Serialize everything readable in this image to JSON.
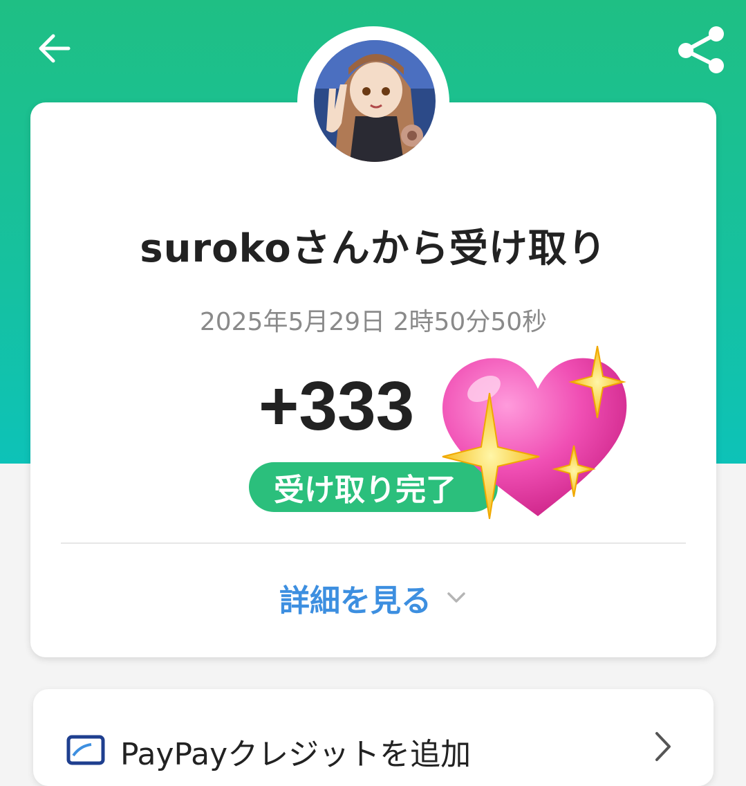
{
  "header": {
    "back_icon": "arrow-left-icon",
    "share_icon": "share-icon",
    "background_color": "#1fbf84"
  },
  "transaction": {
    "title": "surokoさんから受け取り",
    "timestamp": "2025年5月29日 2時50分50秒",
    "amount": "+333",
    "status": "受け取り完了",
    "status_color": "#2bbf7c",
    "sticker": "sparkling-heart-emoji"
  },
  "details": {
    "label": "詳細を見る",
    "icon": "chevron-down-icon",
    "color": "#3d8fe0"
  },
  "credit": {
    "label": "PayPayクレジットを追加",
    "icon": "credit-card-icon",
    "chevron": "chevron-right-icon"
  }
}
